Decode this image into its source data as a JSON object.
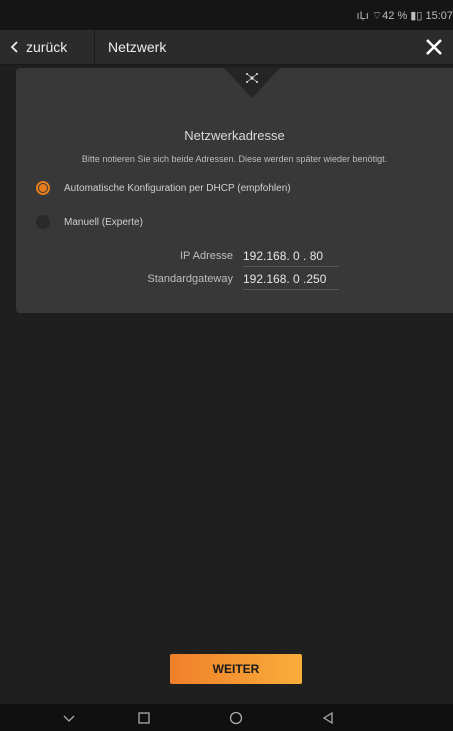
{
  "status_bar": {
    "text": "ıḶı ⌔42 % ▮▯ 15:07"
  },
  "header": {
    "back_label": "zurück",
    "title": "Netzwerk"
  },
  "panel": {
    "title": "Netzwerkadresse",
    "subtitle": "Bitte notieren Sie sich beide Adressen. Diese werden später wieder benötigt.",
    "options": [
      {
        "label": "Automatische Konfiguration per DHCP (empfohlen)",
        "selected": true
      },
      {
        "label": "Manuell (Experte)",
        "selected": false
      }
    ],
    "ip_label": "IP Adresse",
    "ip_value": "192.168.  0  . 80",
    "gateway_label": "Standardgateway",
    "gateway_value": "192.168.  0  .250"
  },
  "footer": {
    "next_label": "WEITER"
  },
  "colors": {
    "accent": "#e87d1e",
    "panel": "#383838",
    "background": "#1f1f1f"
  },
  "icons": [
    "chevron-left-icon",
    "close-icon",
    "network-icon",
    "nav-down-icon",
    "nav-home-icon",
    "nav-circle-icon",
    "nav-back-icon"
  ]
}
